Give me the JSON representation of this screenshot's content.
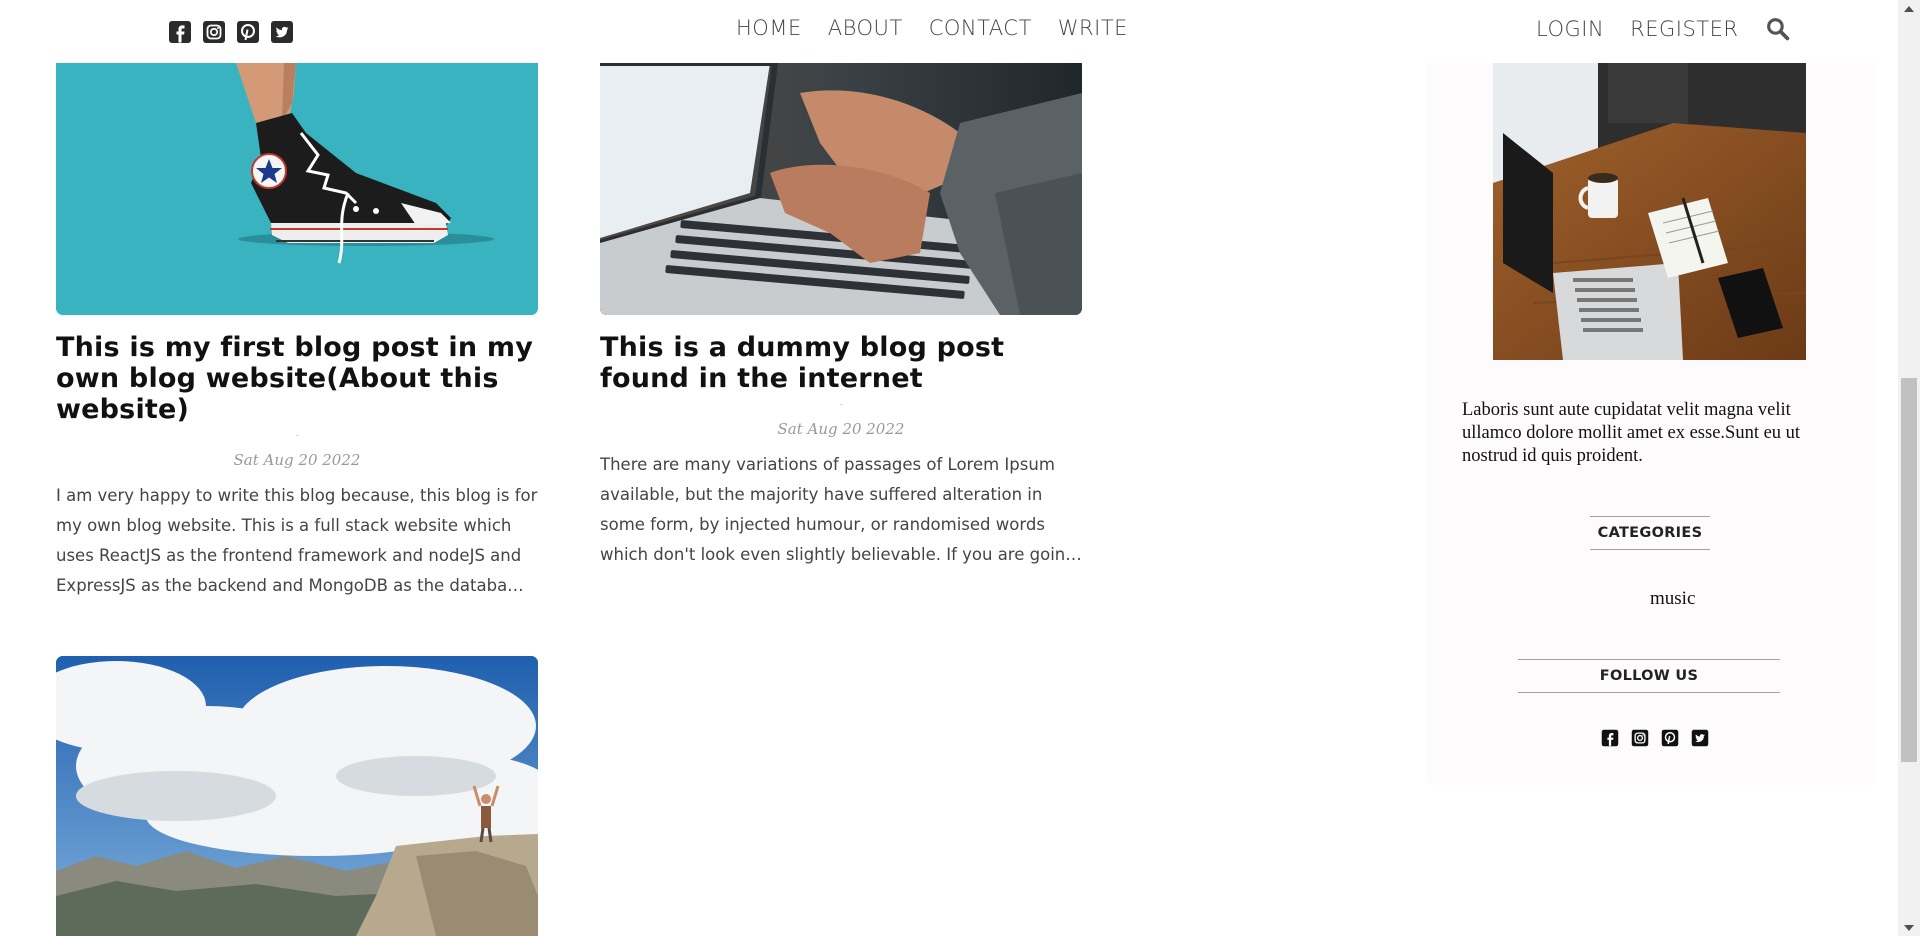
{
  "header": {
    "social": [
      "facebook-square-icon",
      "instagram-square-icon",
      "pinterest-square-icon",
      "twitter-square-icon"
    ],
    "nav": [
      {
        "label": "HOME"
      },
      {
        "label": "ABOUT"
      },
      {
        "label": "CONTACT"
      },
      {
        "label": "WRITE"
      }
    ],
    "auth": {
      "login": "LOGIN",
      "register": "REGISTER"
    },
    "search_icon": "search-icon"
  },
  "posts": [
    {
      "image": "sneaker-illustration",
      "title": "This is my first blog post in my own blog website(About this website)",
      "categories": ".",
      "date": "Sat Aug 20 2022",
      "description": "I am very happy to write this blog because, this blog is for my own blog website. This is a full stack website which uses ReactJS as the frontend framework and nodeJS and ExpressJS as the backend and MongoDB as the databa…"
    },
    {
      "image": "laptop-typing-photo",
      "title": "This is a dummy blog post found in the internet",
      "categories": ".",
      "date": "Sat Aug 20 2022",
      "description": "There are many variations of passages of Lorem Ipsum available, but the majority have suffered alteration in some form, by injected humour, or randomised words which don't look even slightly believable. If you are goin…"
    },
    {
      "image": "mountain-hiker-photo"
    }
  ],
  "sidebar": {
    "image": "desk-laptop-photo",
    "about_text": "Laboris sunt aute cupidatat velit magna velit ullamco dolore mollit amet ex esse.Sunt eu ut nostrud id quis proident.",
    "categories_title": "CATEGORIES",
    "categories": [
      "music"
    ],
    "follow_title": "FOLLOW US",
    "social": [
      "facebook-square-icon",
      "instagram-square-icon",
      "pinterest-square-icon",
      "twitter-square-icon"
    ]
  },
  "colors": {
    "sneaker_bg": "#3ab3c1",
    "sidebar_bg": "#fdfbfb",
    "nav_text": "#444444"
  }
}
